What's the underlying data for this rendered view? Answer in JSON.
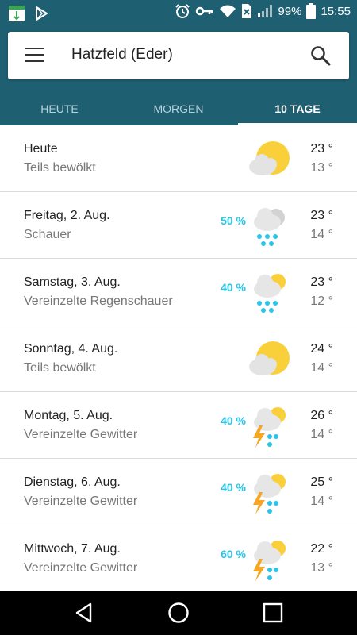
{
  "status_bar": {
    "battery": "99%",
    "time": "15:55",
    "icons": [
      "app-notification-icon",
      "play-store-icon",
      "alarm-icon",
      "vpn-key-icon",
      "wifi-icon",
      "signal-icon",
      "battery-icon"
    ]
  },
  "header": {
    "location": "Hatzfeld (Eder)",
    "tabs": [
      {
        "label": "HEUTE"
      },
      {
        "label": "MORGEN"
      },
      {
        "label": "10 TAGE"
      }
    ],
    "active_tab": "10 TAGE"
  },
  "forecast": [
    {
      "day": "Heute",
      "condition": "Teils bewölkt",
      "precip": "",
      "icon": "partly-cloudy-icon",
      "high": "23 °",
      "low": "13 °"
    },
    {
      "day": "Freitag, 2. Aug.",
      "condition": "Schauer",
      "precip": "50 %",
      "icon": "showers-icon",
      "high": "23 °",
      "low": "14 °"
    },
    {
      "day": "Samstag, 3. Aug.",
      "condition": "Vereinzelte Regenschauer",
      "precip": "40 %",
      "icon": "scattered-showers-icon",
      "high": "23 °",
      "low": "12 °"
    },
    {
      "day": "Sonntag, 4. Aug.",
      "condition": "Teils bewölkt",
      "precip": "",
      "icon": "partly-cloudy-icon",
      "high": "24 °",
      "low": "14 °"
    },
    {
      "day": "Montag, 5. Aug.",
      "condition": "Vereinzelte Gewitter",
      "precip": "40 %",
      "icon": "scattered-thunderstorms-icon",
      "high": "26 °",
      "low": "14 °"
    },
    {
      "day": "Dienstag, 6. Aug.",
      "condition": "Vereinzelte Gewitter",
      "precip": "40 %",
      "icon": "scattered-thunderstorms-icon",
      "high": "25 °",
      "low": "14 °"
    },
    {
      "day": "Mittwoch, 7. Aug.",
      "condition": "Vereinzelte Gewitter",
      "precip": "60 %",
      "icon": "scattered-thunderstorms-icon",
      "high": "22 °",
      "low": "13 °"
    }
  ],
  "colors": {
    "appbar": "#1f5f72",
    "precip": "#29c5e8",
    "sun": "#f9cf3a",
    "cloud": "#e8e8e8",
    "rain": "#29c5e8",
    "lightning": "#f5a623"
  },
  "nav": {
    "icons": [
      "back-icon",
      "home-icon",
      "recents-icon"
    ]
  }
}
